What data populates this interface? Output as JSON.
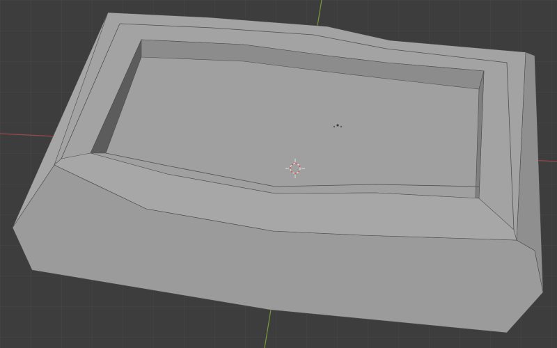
{
  "viewport": {
    "background_color": "#3d3d3d",
    "grid_color": "#464646",
    "x_axis_color": "#9a4a4a",
    "y_axis_color": "#7a9a3a"
  },
  "model": {
    "face_colors": {
      "top": "#a3a3a3",
      "inner_floor": "#a0a0a0",
      "front": "#9b9b9b",
      "left_side": "#a6a6a6",
      "right_side": "#8f8f8f",
      "inner_wall_left": "#5c5c5c",
      "inner_wall_back": "#8c8c8c",
      "inner_wall_right": "#7f7f7f",
      "inner_wall_front": "#a7a7a7",
      "edge": "#4a4a4a"
    }
  },
  "gizmos": {
    "origin_icon": "origin-dot-icon",
    "cursor_icon": "3d-cursor-icon"
  }
}
